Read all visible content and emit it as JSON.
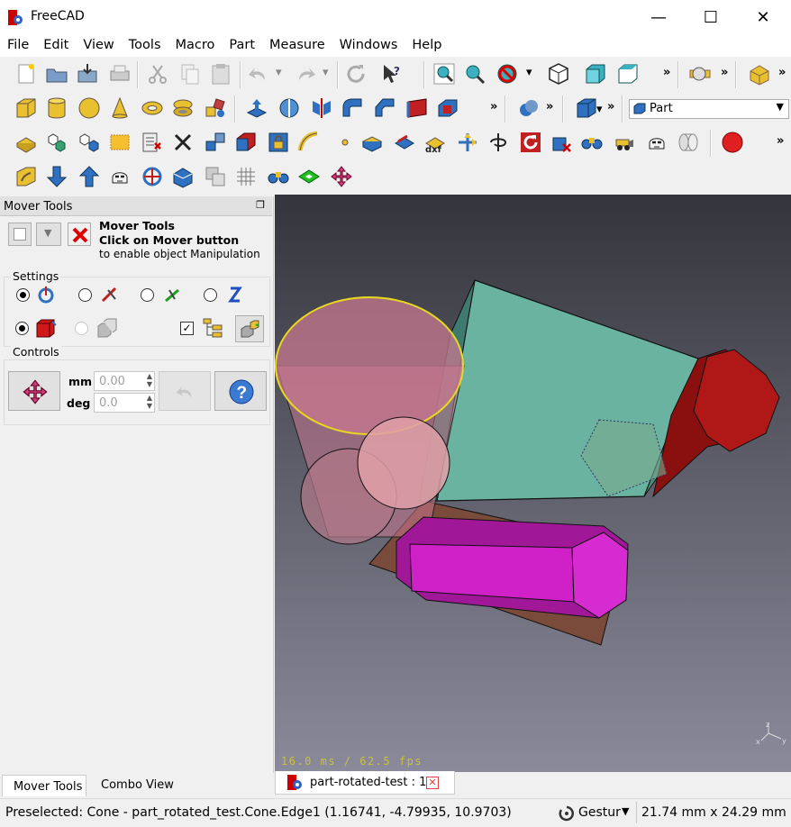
{
  "window": {
    "title": "FreeCAD",
    "minimize": "—",
    "maximize": "☐",
    "close": "✕"
  },
  "menu": [
    "File",
    "Edit",
    "View",
    "Tools",
    "Macro",
    "Part",
    "Measure",
    "Windows",
    "Help"
  ],
  "workbench_selector": {
    "value": "Part"
  },
  "panel": {
    "title": "Mover Tools",
    "heading_line1": "Mover Tools",
    "heading_line2": "Click on Mover button",
    "heading_line3": "to enable object Manipulation",
    "settings_label": "Settings",
    "controls_label": "Controls",
    "mm_label": "mm",
    "deg_label": "deg",
    "mm_value": "0.00",
    "deg_value": "0.0"
  },
  "viewport": {
    "fps_text": "16.0 ms / 62.5 fps"
  },
  "bottom_tabs": {
    "left1": "Mover Tools",
    "left2": "Combo View",
    "doc_tab": "part-rotated-test : 1*"
  },
  "status": {
    "message": "Preselected: Cone - part_rotated_test.Cone.Edge1 (1.16741, -4.79935, 10.9703)",
    "nav_style": "Gestur",
    "dimensions": "21.74 mm x 24.29 mm"
  },
  "colors": {
    "accent_red": "#e02020",
    "cylinder_pink": "#c87890",
    "box_teal": "#6ab3a0",
    "prism_magenta": "#d020c8",
    "hex_red": "#b01818",
    "base_brown": "#7a4a3a"
  }
}
